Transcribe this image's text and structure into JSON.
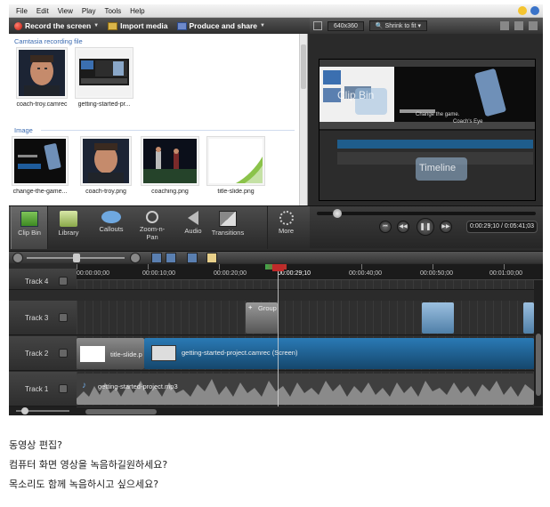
{
  "menu": [
    "File",
    "Edit",
    "View",
    "Play",
    "Tools",
    "Help"
  ],
  "toolbar": {
    "record": "Record the screen",
    "import": "Import media",
    "produce": "Produce and share"
  },
  "preview": {
    "size": "640x360",
    "fit": "Shrink to fit"
  },
  "clip_bin": {
    "section_recording": "Camtasia recording file",
    "section_image": "Image",
    "recordings": [
      "coach-troy.camrec",
      "getting-started-pr..."
    ],
    "images": [
      "change-the-game...",
      "coach-troy.png",
      "coaching.png",
      "title-slide.png"
    ]
  },
  "screen_labels": {
    "clip_bin": "Clip Bin",
    "timeline": "Timeline",
    "change_game": "Change the game.",
    "coachs_eye": "Coach's Eye"
  },
  "tabs": [
    {
      "label": "Clip Bin",
      "icon": "clip-bin-icon"
    },
    {
      "label": "Library",
      "icon": "library-folder-icon"
    },
    {
      "label": "Callouts",
      "icon": "callout-bubble-icon"
    },
    {
      "label": "Zoom-n-Pan",
      "icon": "magnifier-icon"
    },
    {
      "label": "Audio",
      "icon": "speaker-icon"
    },
    {
      "label": "Transitions",
      "icon": "transitions-icon"
    },
    {
      "label": "More",
      "icon": "more-dots-icon"
    }
  ],
  "transport": {
    "timecode": "0:00:29;10 / 0:05:41;03"
  },
  "ruler": {
    "labels": [
      "00:00:00;00",
      "00:00:10;00",
      "00:00:20;00",
      "00:00:29;10",
      "00:00:40;00",
      "00:00:50;00",
      "00:01:00;00"
    ],
    "playhead": "00:00:29;10"
  },
  "tracks": [
    {
      "name": "Track 4"
    },
    {
      "name": "Track 3",
      "group_label": "Group"
    },
    {
      "name": "Track 2",
      "clip_title": "title-slide.p",
      "clip_main": "getting-started-project.camrec (Screen)"
    },
    {
      "name": "Track 1",
      "audio": "getting-started-project.mp3"
    }
  ],
  "caption": [
    "동영상 편집?",
    "컴퓨터 화면 영상을 녹음하길원하세요?",
    "목소리도 함께 녹음하시고 싶으세요?"
  ],
  "colors": {
    "accent_blue": "#3a6ab0",
    "clip_blue": "#1f5d8c",
    "record_red": "#c1160a"
  }
}
